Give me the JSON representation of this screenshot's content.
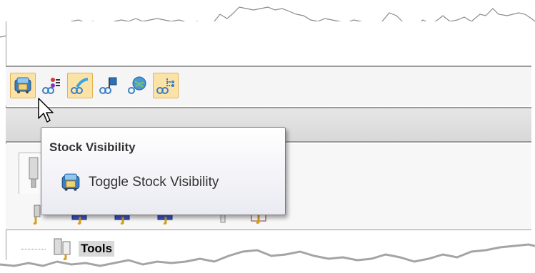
{
  "toolbar": {
    "buttons": [
      {
        "name": "stock-visibility",
        "icon": "stock-visibility-icon",
        "active": true
      },
      {
        "name": "operation-list",
        "icon": "operation-list-icon",
        "active": false
      },
      {
        "name": "toolpath-display",
        "icon": "toolpath-icon",
        "active": true
      },
      {
        "name": "toolpath-flag",
        "icon": "toolpath-flag-icon",
        "active": false
      },
      {
        "name": "stock-globe",
        "icon": "globe-icon",
        "active": false
      },
      {
        "name": "toolpath-tree",
        "icon": "toolpath-tree-icon",
        "active": true
      }
    ]
  },
  "tooltip": {
    "title": "Stock Visibility",
    "command_label": "Toggle Stock Visibility",
    "icon": "stock-visibility-icon"
  },
  "tree": {
    "item_label": "Tools",
    "icon": "tools-icon"
  },
  "colors": {
    "active_button_bg": "#fbe3a8",
    "active_button_border": "#e2b259",
    "tooltip_border": "#767676"
  }
}
